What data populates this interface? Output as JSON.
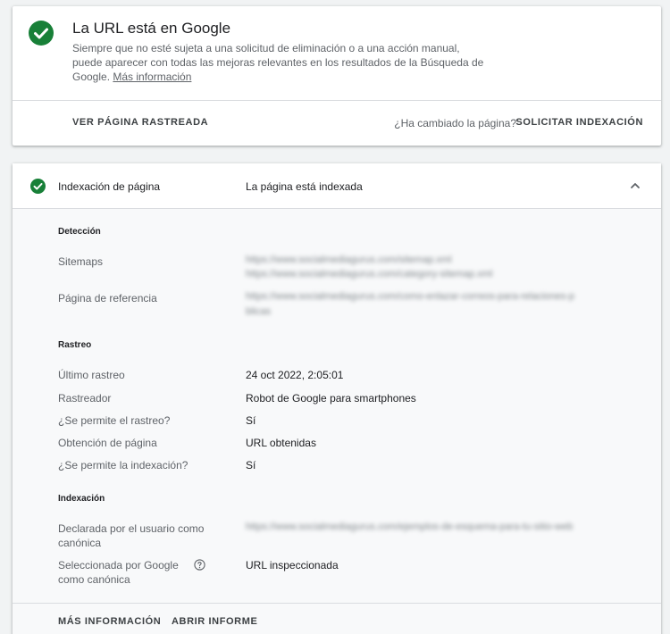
{
  "status": {
    "title": "La URL está en Google",
    "description": "Siempre que no esté sujeta a una solicitud de eliminación o a una acción manual, puede aparecer con todas las mejoras relevantes en los resultados de la Búsqueda de Google.",
    "more_link": "Más información",
    "view_crawled": "VER PÁGINA RASTREADA",
    "changed_question": "¿Ha cambiado la página?",
    "request_indexing": "SOLICITAR INDEXACIÓN",
    "accent_color": "#188038"
  },
  "indexing": {
    "label": "Indexación de página",
    "value": "La página está indexada",
    "sections": {
      "detection": {
        "title": "Detección",
        "sitemaps_label": "Sitemaps",
        "sitemaps_value_1": "https://www.socialmediagurus.com/sitemap.xml",
        "sitemaps_value_2": "https://www.socialmediagurus.com/category-sitemap.xml",
        "referring_label": "Página de referencia",
        "referring_value_1": "https://www.socialmediagurus.com/como-enlazar-correos-para-relaciones-p",
        "referring_value_2": "blicas"
      },
      "crawl": {
        "title": "Rastreo",
        "last_crawl_label": "Último rastreo",
        "last_crawl_value": "24 oct 2022, 2:05:01",
        "crawler_label": "Rastreador",
        "crawler_value": "Robot de Google para smartphones",
        "crawl_allowed_label": "¿Se permite el rastreo?",
        "crawl_allowed_value": "Sí",
        "fetch_label": "Obtención de página",
        "fetch_value": "URL obtenidas",
        "index_allowed_label": "¿Se permite la indexación?",
        "index_allowed_value": "Sí"
      },
      "indexing": {
        "title": "Indexación",
        "user_canonical_label": "Declarada por el usuario como canónica",
        "user_canonical_value": "https://www.socialmediagurus.com/ejemplos-de-esquema-para-tu-sitio-web",
        "google_canonical_label": "Seleccionada por Google como canónica",
        "google_canonical_value": "URL inspeccionada"
      }
    },
    "more_info": "MÁS INFORMACIÓN",
    "open_report": "ABRIR INFORME"
  }
}
